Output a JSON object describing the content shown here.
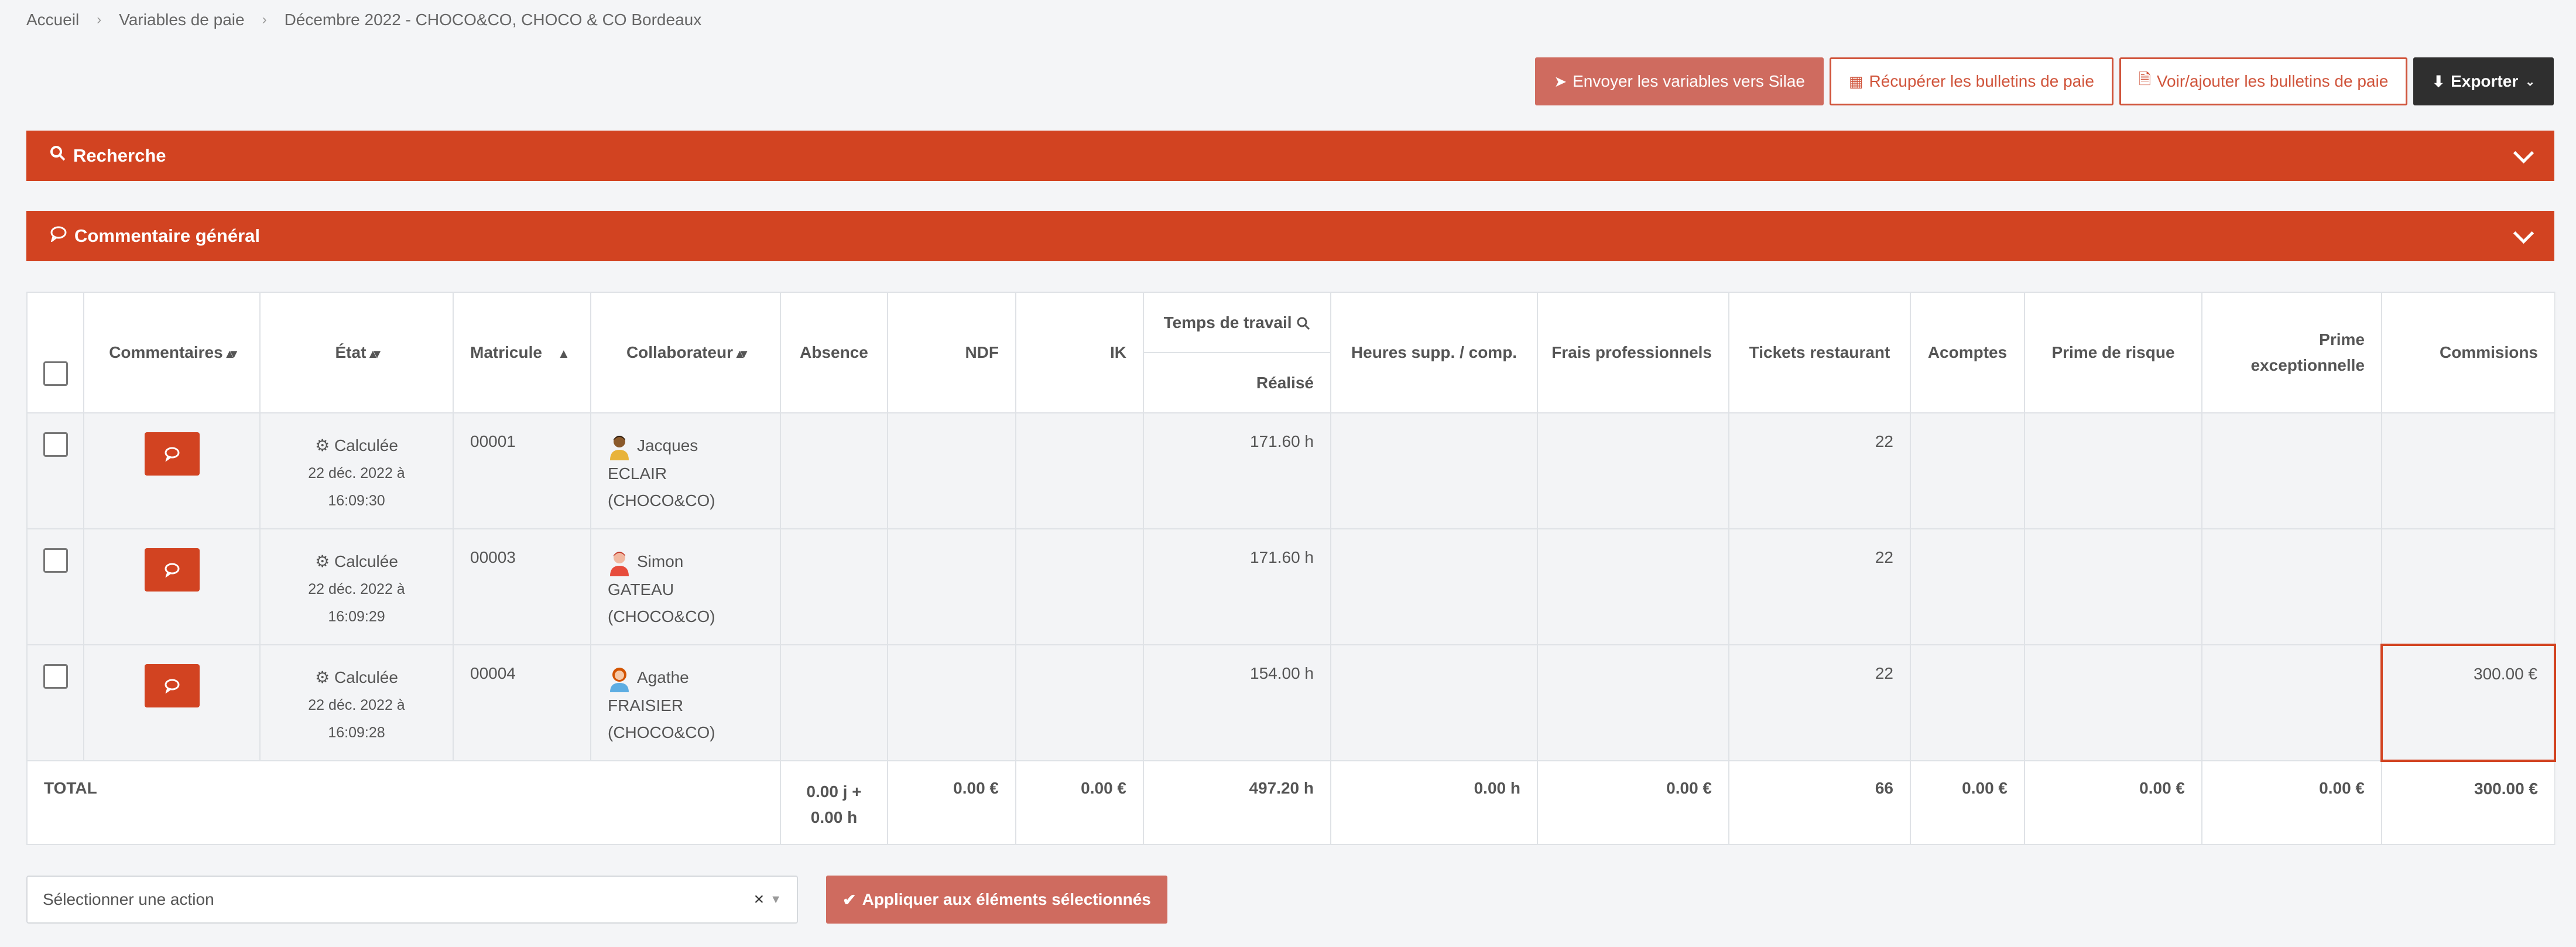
{
  "breadcrumb": [
    "Accueil",
    "Variables de paie",
    "Décembre 2022 - CHOCO&CO, CHOCO & CO Bordeaux"
  ],
  "toolbar": {
    "send": "Envoyer les variables vers Silae",
    "retrieve": "Récupérer les bulletins de paie",
    "view_add": "Voir/ajouter les bulletins de paie",
    "export": "Exporter"
  },
  "panels": {
    "search": "Recherche",
    "comment": "Commentaire général"
  },
  "table": {
    "headers": {
      "comments": "Commentaires",
      "state": "État",
      "matricule": "Matricule",
      "collaborator": "Collaborateur",
      "absence": "Absence",
      "ndf": "NDF",
      "ik": "IK",
      "worktime": "Temps de travail",
      "realized": "Réalisé",
      "overtime": "Heures supp. / comp.",
      "fees": "Frais professionnels",
      "tickets": "Tickets restaurant",
      "advances": "Acomptes",
      "risk": "Prime de risque",
      "exceptional": "Prime exceptionnelle",
      "commissions": "Commisions"
    },
    "rows": [
      {
        "state": "Calculée",
        "date": "22 déc. 2022 à",
        "time": "16:09:30",
        "matricule": "00001",
        "first": "Jacques",
        "last": "ECLAIR",
        "company": "(CHOCO&CO)",
        "realized": "171.60 h",
        "tickets": "22",
        "commissions": ""
      },
      {
        "state": "Calculée",
        "date": "22 déc. 2022 à",
        "time": "16:09:29",
        "matricule": "00003",
        "first": "Simon",
        "last": "GATEAU",
        "company": "(CHOCO&CO)",
        "realized": "171.60 h",
        "tickets": "22",
        "commissions": ""
      },
      {
        "state": "Calculée",
        "date": "22 déc. 2022 à",
        "time": "16:09:28",
        "matricule": "00004",
        "first": "Agathe",
        "last": "FRAISIER",
        "company": "(CHOCO&CO)",
        "realized": "154.00 h",
        "tickets": "22",
        "commissions": "300.00 €"
      }
    ],
    "total": {
      "label": "TOTAL",
      "absence_days": "0.00 j +",
      "absence_hours": "0.00 h",
      "ndf": "0.00 €",
      "ik": "0.00 €",
      "realized": "497.20 h",
      "overtime": "0.00 h",
      "fees": "0.00 €",
      "tickets": "66",
      "advances": "0.00 €",
      "risk": "0.00 €",
      "exceptional": "0.00 €",
      "commissions": "300.00 €"
    }
  },
  "action": {
    "placeholder": "Sélectionner une action",
    "apply": "Appliquer aux éléments sélectionnés"
  },
  "colors": {
    "accent": "#d24321",
    "muted_accent": "#cf6b5f",
    "dark": "#2f2f2f"
  }
}
